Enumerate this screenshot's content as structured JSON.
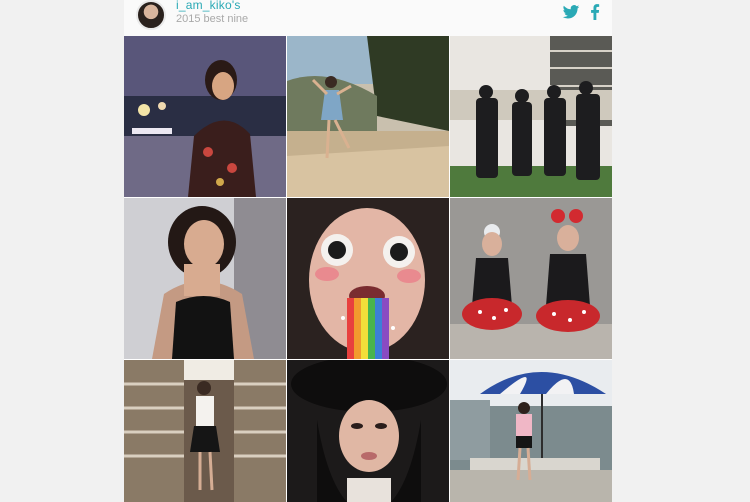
{
  "profile": {
    "username": "i_am_kiko's",
    "subtitle": "2015 best nine"
  },
  "share": {
    "icons": [
      "twitter-icon",
      "facebook-icon"
    ],
    "accent": "#2aa9b5"
  },
  "grid": {
    "columns": 3,
    "rows": 3,
    "photos": [
      "night-harbor-portrait",
      "outdoor-pose-dress",
      "group-black-outfits",
      "black-top-portrait",
      "rainbow-filter-closeup",
      "minnie-costume-pair",
      "bookstore-pose",
      "hat-portrait",
      "umbrella-table-pose"
    ]
  }
}
